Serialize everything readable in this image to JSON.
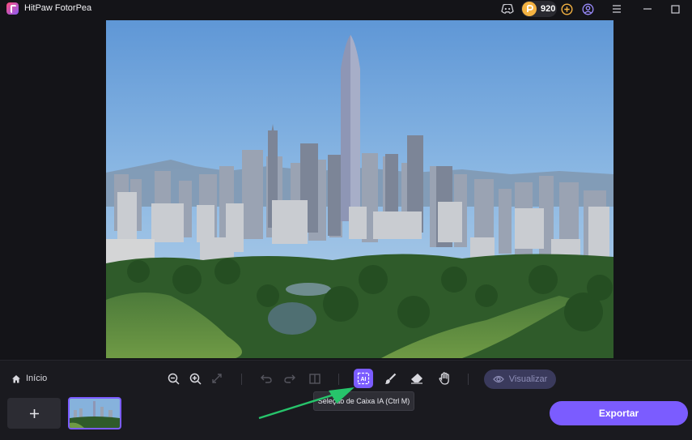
{
  "app": {
    "title": "HitPaw FotorPea"
  },
  "titlebar": {
    "coins": "920"
  },
  "toolbar": {
    "home_label": "Início",
    "visualize_label": "Visualizar",
    "ai_tooltip": "Seleção de Caixa IA (Ctrl M)",
    "ai_icon_text": "AI"
  },
  "bottom": {
    "export_label": "Exportar",
    "add_symbol": "+"
  },
  "colors": {
    "accent": "#7b5cff",
    "coin": "#f5b342",
    "background": "#141418"
  },
  "icons": [
    "app-logo-icon",
    "discord-icon",
    "coin-icon",
    "plus-circle-icon",
    "account-icon",
    "hamburger-menu-icon",
    "minimize-icon",
    "maximize-icon",
    "home-icon",
    "zoom-out-icon",
    "zoom-in-icon",
    "fit-screen-icon",
    "undo-icon",
    "redo-icon",
    "compare-icon",
    "ai-box-select-icon",
    "brush-icon",
    "eraser-icon",
    "hand-icon",
    "eye-icon",
    "plus-icon"
  ]
}
